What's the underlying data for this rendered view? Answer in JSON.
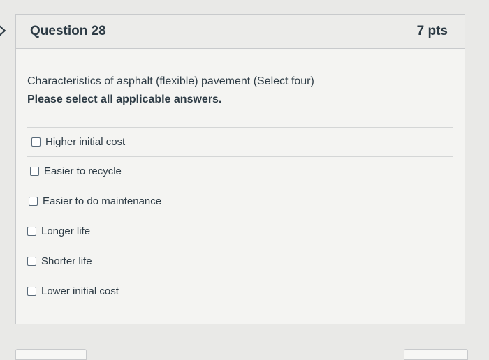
{
  "question": {
    "title": "Question 28",
    "points": "7 pts",
    "text": "Characteristics of asphalt (flexible) pavement (Select four)",
    "instruction": "Please select all applicable answers.",
    "answers": [
      {
        "label": "Higher initial cost",
        "checked": false
      },
      {
        "label": "Easier to recycle",
        "checked": false
      },
      {
        "label": "Easier to do maintenance",
        "checked": false
      },
      {
        "label": "Longer life",
        "checked": false
      },
      {
        "label": "Shorter life",
        "checked": false
      },
      {
        "label": "Lower initial cost",
        "checked": false
      }
    ]
  },
  "colors": {
    "page_background": "#e9e9e7",
    "card_background": "#f4f4f2",
    "header_background": "#ececea",
    "text": "#2d3b45",
    "border": "#c8cacc"
  },
  "icons": {
    "collapse": "chevron-right-icon"
  }
}
